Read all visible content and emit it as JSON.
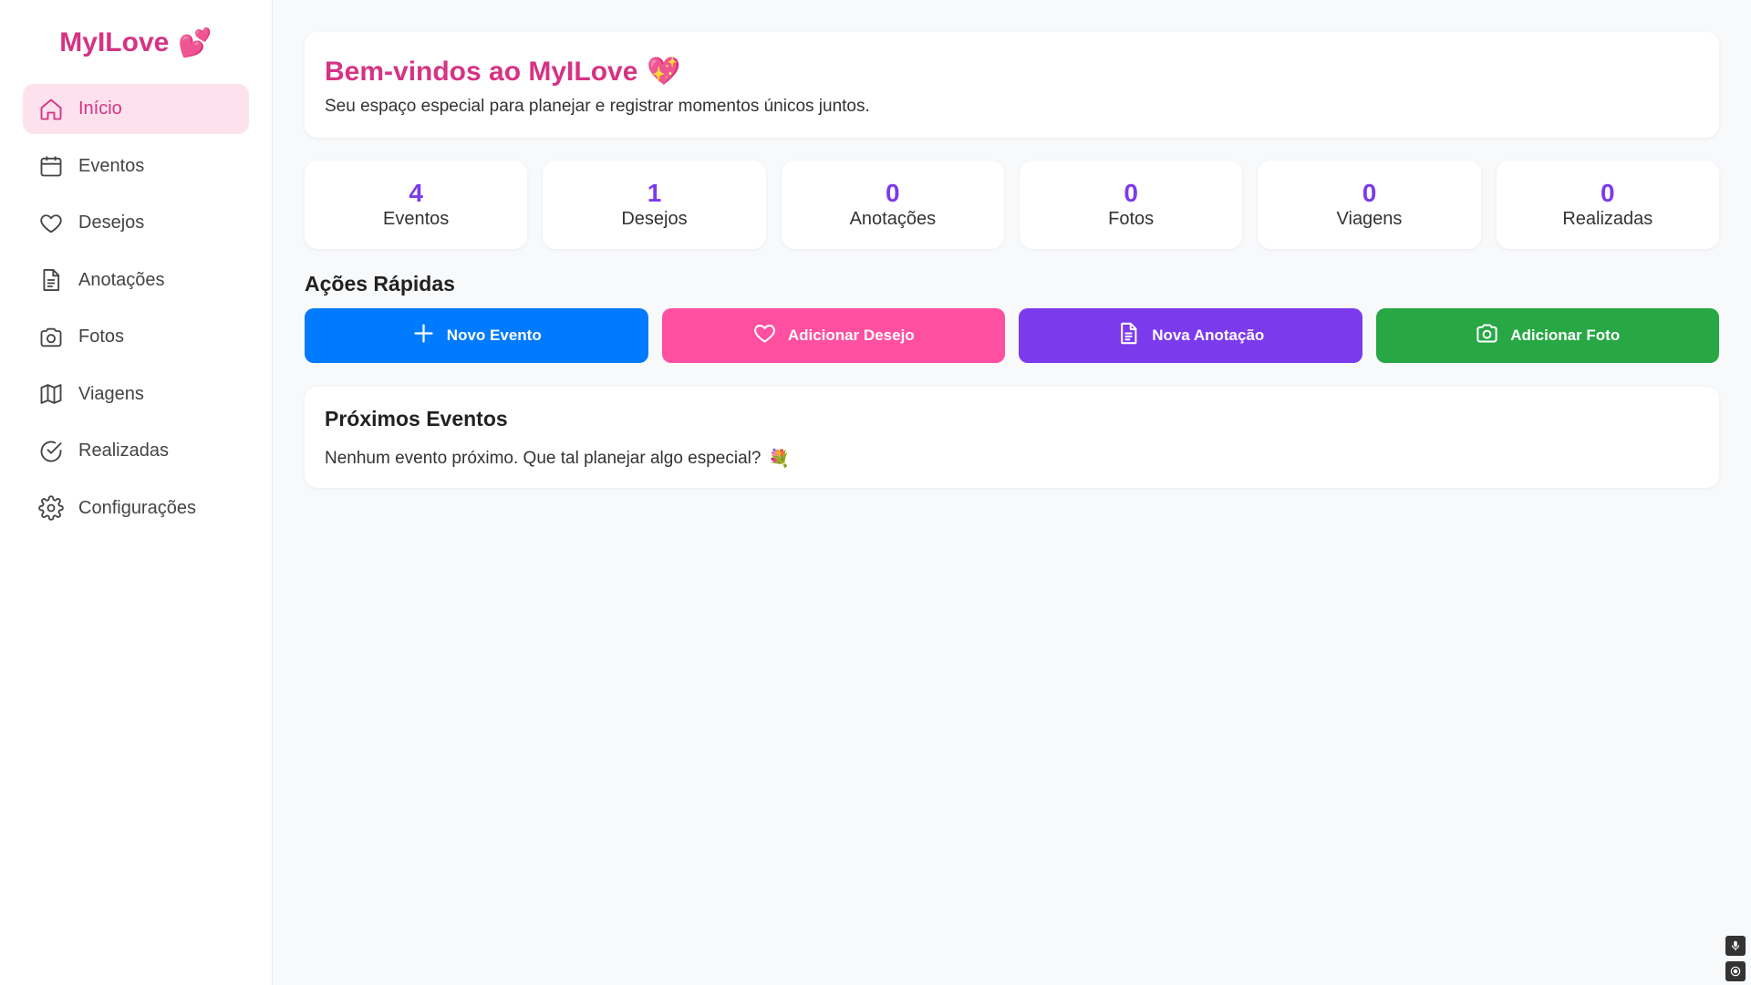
{
  "brand": {
    "name": "MyILove",
    "emoji": "💕"
  },
  "sidebar": {
    "items": [
      {
        "label": "Início",
        "icon": "home-icon",
        "active": true
      },
      {
        "label": "Eventos",
        "icon": "calendar-icon"
      },
      {
        "label": "Desejos",
        "icon": "heart-icon"
      },
      {
        "label": "Anotações",
        "icon": "document-icon"
      },
      {
        "label": "Fotos",
        "icon": "camera-icon"
      },
      {
        "label": "Viagens",
        "icon": "map-icon"
      },
      {
        "label": "Realizadas",
        "icon": "check-circle-icon"
      },
      {
        "label": "Configurações",
        "icon": "gear-icon"
      }
    ]
  },
  "welcome": {
    "title": "Bem-vindos ao MyILove",
    "emoji": "💖",
    "subtitle": "Seu espaço especial para planejar e registrar momentos únicos juntos."
  },
  "stats": [
    {
      "value": "4",
      "label": "Eventos"
    },
    {
      "value": "1",
      "label": "Desejos"
    },
    {
      "value": "0",
      "label": "Anotações"
    },
    {
      "value": "0",
      "label": "Fotos"
    },
    {
      "value": "0",
      "label": "Viagens"
    },
    {
      "value": "0",
      "label": "Realizadas"
    }
  ],
  "quick_actions": {
    "title": "Ações Rápidas",
    "buttons": [
      {
        "label": "Novo Evento",
        "icon": "plus-icon",
        "color": "#007bff"
      },
      {
        "label": "Adicionar Desejo",
        "icon": "heart-icon",
        "color": "#ff4fa0"
      },
      {
        "label": "Nova Anotação",
        "icon": "document-icon",
        "color": "#7c3aed"
      },
      {
        "label": "Adicionar Foto",
        "icon": "camera-icon",
        "color": "#28a745"
      }
    ]
  },
  "upcoming": {
    "title": "Próximos Eventos",
    "empty_message": "Nenhum evento próximo. Que tal planejar algo especial?",
    "emoji": "💐"
  },
  "colors": {
    "accent": "#d63384",
    "stat_number": "#7c3aed",
    "active_bg": "#fde2ee"
  },
  "corner_tools": [
    {
      "icon": "microphone-icon"
    },
    {
      "icon": "settings-circle-icon"
    }
  ]
}
